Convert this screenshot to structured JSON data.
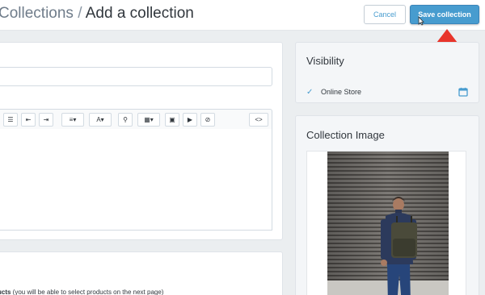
{
  "header": {
    "breadcrumb_link": "Collections",
    "breadcrumb_sep": " / ",
    "page_title": "Add a collection",
    "cancel_label": "Cancel",
    "save_label": "Save collection"
  },
  "editor": {
    "toolbar": [
      {
        "name": "bulleted-list-icon",
        "glyph": "☰"
      },
      {
        "name": "outdent-icon",
        "glyph": "⇤"
      },
      {
        "name": "indent-icon",
        "glyph": "⇥"
      },
      {
        "name": "align-icon",
        "glyph": "≡▾"
      },
      {
        "name": "text-color-icon",
        "glyph": "A▾"
      },
      {
        "name": "link-icon",
        "glyph": "⚲"
      },
      {
        "name": "table-icon",
        "glyph": "▦▾"
      },
      {
        "name": "image-icon",
        "glyph": "▣"
      },
      {
        "name": "video-icon",
        "glyph": "▶"
      },
      {
        "name": "clear-formatting-icon",
        "glyph": "⊘"
      },
      {
        "name": "html-icon",
        "glyph": "<>"
      }
    ]
  },
  "conditions": {
    "option_bold": "ucts",
    "option_rest": " (you will be able to select products on the next page)"
  },
  "visibility": {
    "title": "Visibility",
    "channel_label": "Online Store",
    "checked": true
  },
  "collection_image": {
    "title": "Collection Image"
  },
  "colors": {
    "accent": "#479ccf",
    "arrow": "#e8352b",
    "background": "#ebeef0"
  }
}
